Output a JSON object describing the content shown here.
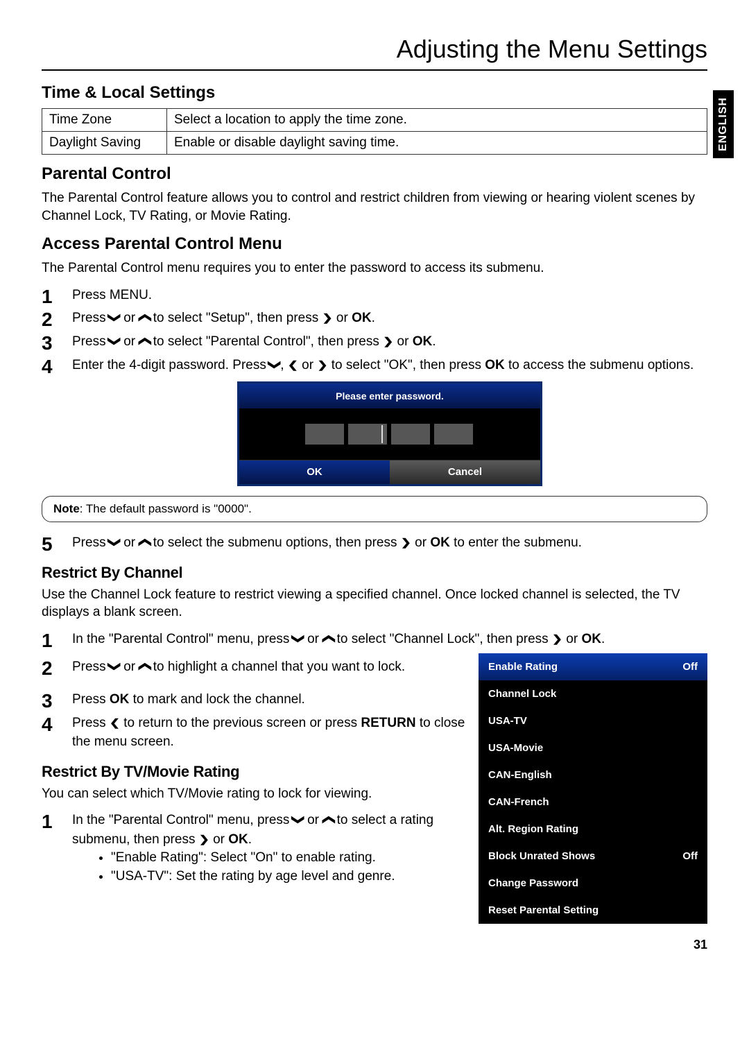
{
  "page": {
    "title": "Adjusting the Menu Settings",
    "side_tab": "ENGLISH",
    "number": "31"
  },
  "time_local": {
    "heading": "Time & Local Settings",
    "rows": [
      {
        "label": "Time Zone",
        "desc": "Select a location to apply the time zone."
      },
      {
        "label": "Daylight Saving",
        "desc": "Enable or disable daylight saving time."
      }
    ]
  },
  "parental": {
    "heading": "Parental Control",
    "intro": "The Parental Control feature allows you to control and restrict children from viewing or hearing violent scenes by Channel Lock, TV Rating, or Movie Rating."
  },
  "access": {
    "heading": "Access Parental Control Menu",
    "intro": "The Parental Control menu requires you to enter the password to access its submenu.",
    "steps": {
      "s1": "Press MENU.",
      "s2a": "Press ",
      "s2b": " or ",
      "s2c": " to select \"Setup\", then press ",
      "s2d": " or ",
      "s2e": ".",
      "s3a": "Press ",
      "s3b": " or ",
      "s3c": " to select \"Parental Control\", then press ",
      "s3d": " or ",
      "s3e": ".",
      "s4a": "Enter the 4-digit password. Press ",
      "s4b": ", ",
      "s4c": " or ",
      "s4d": " to select \"OK\", then press ",
      "s4e": " to access the submenu options.",
      "s5a": "Press ",
      "s5b": " or ",
      "s5c": " to select the submenu options, then press ",
      "s5d": " or ",
      "s5e": " to enter the submenu."
    },
    "dialog": {
      "prompt": "Please enter password.",
      "ok": "OK",
      "cancel": "Cancel"
    },
    "note_label": "Note",
    "note_text": ": The default password is \"0000\"."
  },
  "restrict_channel": {
    "heading": "Restrict By Channel",
    "intro": "Use the Channel Lock feature to restrict viewing a specified channel. Once locked channel is selected, the TV displays a blank screen.",
    "steps": {
      "s1a": "In the \"Parental Control\" menu, press ",
      "s1b": " or ",
      "s1c": " to select \"Channel Lock\", then press ",
      "s1d": " or ",
      "s1e": ".",
      "s2a": "Press ",
      "s2b": " or ",
      "s2c": " to highlight a channel that you want to lock.",
      "s3a": "Press ",
      "s3b": " to mark and lock the channel.",
      "s4a": "Press ",
      "s4b": " to return to the previous screen or press ",
      "s4c": " to close the menu screen."
    }
  },
  "restrict_rating": {
    "heading": "Restrict By TV/Movie Rating",
    "intro": "You can select which TV/Movie rating to lock for viewing.",
    "step1a": "In the \"Parental Control\" menu, press ",
    "step1b": " or ",
    "step1c": " to select a rating submenu, then press ",
    "step1d": " or ",
    "step1e": ".",
    "bullet1": "\"Enable Rating\": Select \"On\" to enable rating.",
    "bullet2": "\"USA-TV\": Set the rating by age level and genre."
  },
  "menu_panel": {
    "items": [
      {
        "label": "Enable Rating",
        "value": "Off",
        "hi": true
      },
      {
        "label": "Channel Lock",
        "value": ""
      },
      {
        "label": "USA-TV",
        "value": ""
      },
      {
        "label": "USA-Movie",
        "value": ""
      },
      {
        "label": "CAN-English",
        "value": ""
      },
      {
        "label": "CAN-French",
        "value": ""
      },
      {
        "label": "Alt. Region Rating",
        "value": ""
      },
      {
        "label": "Block Unrated Shows",
        "value": "Off"
      },
      {
        "label": "Change Password",
        "value": ""
      },
      {
        "label": "Reset Parental Setting",
        "value": ""
      }
    ]
  },
  "keys": {
    "ok": "OK",
    "return": "RETURN"
  },
  "icons": {
    "down": "❯",
    "up": "❯",
    "left": "❮",
    "right": "❯"
  }
}
